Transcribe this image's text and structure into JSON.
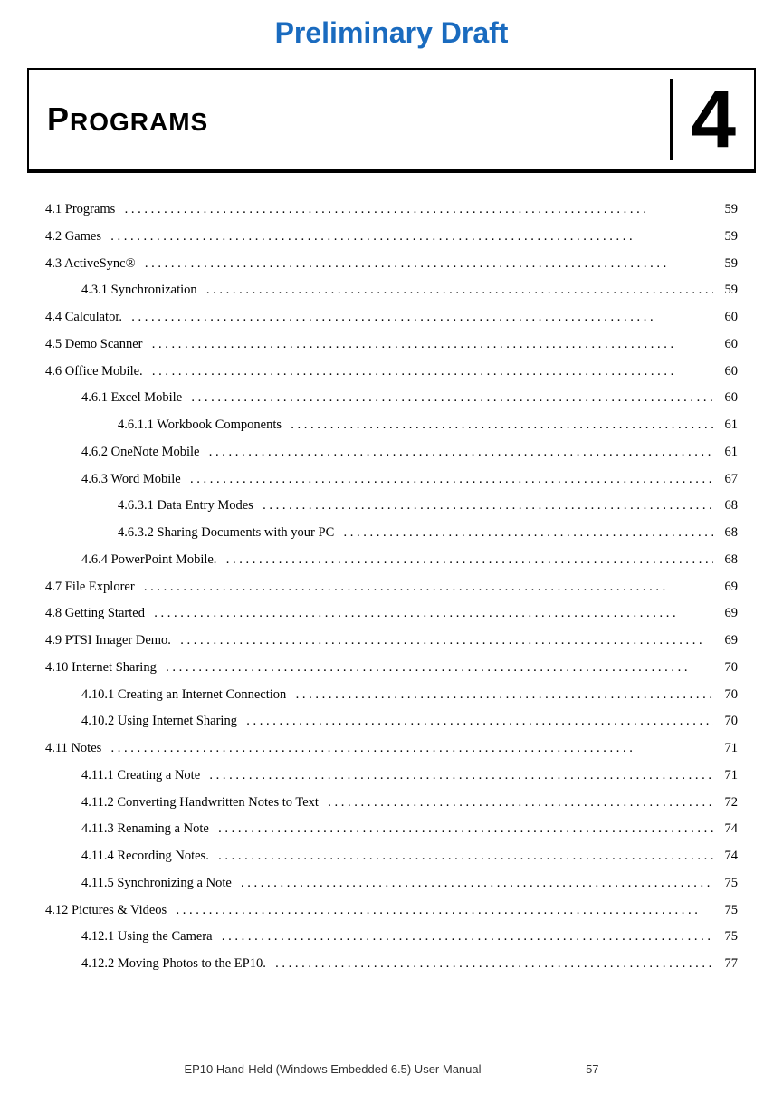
{
  "header": {
    "preliminary_draft": "Preliminary Draft",
    "chapter_title": "Programs",
    "chapter_number": "4"
  },
  "toc": {
    "entries": [
      {
        "level": 1,
        "label": "4.1 Programs",
        "page": "59"
      },
      {
        "level": 1,
        "label": "4.2 Games",
        "page": "59"
      },
      {
        "level": 1,
        "label": "4.3 ActiveSync®",
        "page": "59"
      },
      {
        "level": 2,
        "label": "4.3.1 Synchronization",
        "page": "59"
      },
      {
        "level": 1,
        "label": "4.4 Calculator.",
        "page": "60"
      },
      {
        "level": 1,
        "label": "4.5 Demo Scanner",
        "page": "60"
      },
      {
        "level": 1,
        "label": "4.6 Office Mobile.",
        "page": "60"
      },
      {
        "level": 2,
        "label": "4.6.1 Excel Mobile",
        "page": "60"
      },
      {
        "level": 3,
        "label": "4.6.1.1 Workbook Components",
        "page": "61"
      },
      {
        "level": 2,
        "label": "4.6.2 OneNote Mobile",
        "page": "61"
      },
      {
        "level": 2,
        "label": "4.6.3 Word Mobile",
        "page": "67"
      },
      {
        "level": 3,
        "label": "4.6.3.1 Data Entry Modes",
        "page": "68"
      },
      {
        "level": 3,
        "label": "4.6.3.2 Sharing Documents with your PC",
        "page": "68"
      },
      {
        "level": 2,
        "label": "4.6.4 PowerPoint Mobile.",
        "page": "68"
      },
      {
        "level": 1,
        "label": "4.7 File Explorer",
        "page": "69"
      },
      {
        "level": 1,
        "label": "4.8 Getting Started",
        "page": "69"
      },
      {
        "level": 1,
        "label": "4.9 PTSI Imager Demo.",
        "page": "69"
      },
      {
        "level": 1,
        "label": "4.10 Internet Sharing",
        "page": "70"
      },
      {
        "level": 2,
        "label": "4.10.1 Creating an Internet Connection",
        "page": "70"
      },
      {
        "level": 2,
        "label": "4.10.2 Using Internet Sharing",
        "page": "70"
      },
      {
        "level": 1,
        "label": "4.11 Notes",
        "page": "71"
      },
      {
        "level": 2,
        "label": "4.11.1 Creating a Note",
        "page": "71"
      },
      {
        "level": 2,
        "label": "4.11.2 Converting Handwritten Notes to Text",
        "page": "72"
      },
      {
        "level": 2,
        "label": "4.11.3 Renaming a Note",
        "page": "74"
      },
      {
        "level": 2,
        "label": "4.11.4 Recording Notes.",
        "page": "74"
      },
      {
        "level": 2,
        "label": "4.11.5 Synchronizing a Note",
        "page": "75"
      },
      {
        "level": 1,
        "label": "4.12 Pictures & Videos",
        "page": "75"
      },
      {
        "level": 2,
        "label": "4.12.1 Using the Camera",
        "page": "75"
      },
      {
        "level": 2,
        "label": "4.12.2 Moving Photos to the EP10.",
        "page": "77"
      }
    ]
  },
  "footer": {
    "text": "EP10 Hand-Held (Windows Embedded 6.5) User Manual",
    "page": "57"
  }
}
